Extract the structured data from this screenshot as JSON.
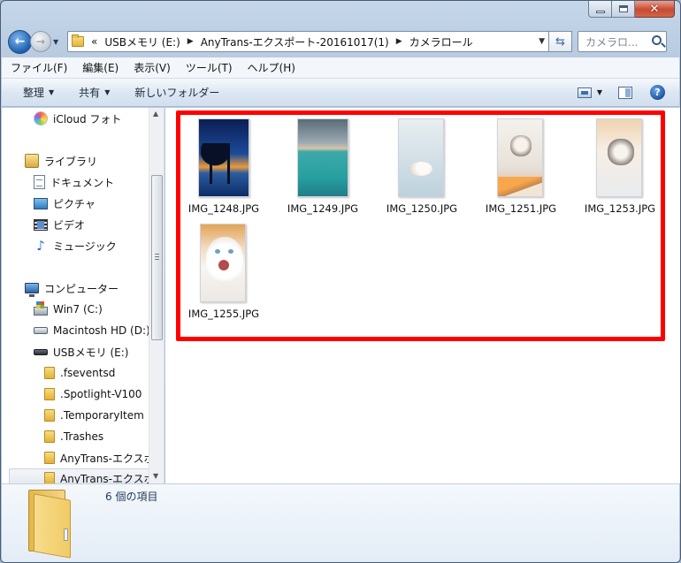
{
  "address": {
    "overflow": "«",
    "crumbs": [
      "USBメモリ (E:)",
      "AnyTrans-エクスポート-20161017(1)",
      "カメラロール"
    ]
  },
  "search": {
    "placeholder": "カメラロ..."
  },
  "menu": [
    "ファイル(F)",
    "編集(E)",
    "表示(V)",
    "ツール(T)",
    "ヘルプ(H)"
  ],
  "toolbar": {
    "organize": "整理",
    "share": "共有",
    "new_folder": "新しいフォルダー"
  },
  "nav": {
    "icloud": "iCloud フォト",
    "libraries": "ライブラリ",
    "documents": "ドキュメント",
    "pictures": "ピクチャ",
    "videos": "ビデオ",
    "music": "ミュージック",
    "computer": "コンピューター",
    "win7": "Win7 (C:)",
    "mac": "Macintosh HD (D:)",
    "usb": "USBメモリ (E:)",
    "folders": [
      ".fseventsd",
      ".Spotlight-V100",
      ".TemporaryItem",
      ".Trashes",
      "AnyTrans-エクスポ",
      "AnyTrans-エクスポ"
    ]
  },
  "files": [
    "IMG_1248.JPG",
    "IMG_1249.JPG",
    "IMG_1250.JPG",
    "IMG_1251.JPG",
    "IMG_1253.JPG",
    "IMG_1255.JPG"
  ],
  "status": {
    "item_count": "6 個の項目"
  },
  "colors": {
    "highlight": "#ff0000",
    "accent": "#1d5fb0"
  }
}
